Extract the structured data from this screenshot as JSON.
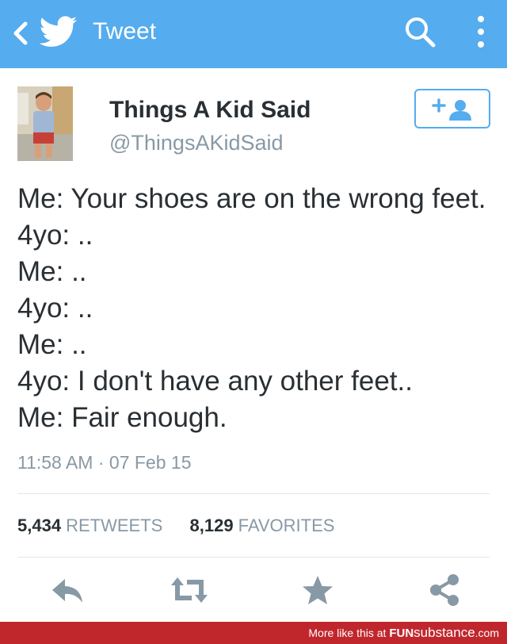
{
  "topbar": {
    "title": "Tweet",
    "background_color": "#55acee",
    "icons": [
      "chevron-left-icon",
      "twitter-bird-icon",
      "search-icon",
      "overflow-menu-icon"
    ]
  },
  "header": {
    "display_name": "Things A Kid Said",
    "handle": "@ThingsAKidSaid",
    "follow_button_icon": "add-user-icon"
  },
  "tweet": {
    "lines": [
      "Me: Your shoes are on the wrong feet.",
      "4yo: ..",
      "Me: ..",
      "4yo: ..",
      "Me: ..",
      "4yo: I don't have any other feet..",
      "Me: Fair enough."
    ],
    "timestamp": "11:58 AM · 07 Feb 15"
  },
  "stats": {
    "retweets_count": "5,434",
    "retweets_label": "RETWEETS",
    "favorites_count": "8,129",
    "favorites_label": "FAVORITES"
  },
  "actions": [
    "reply-icon",
    "retweet-icon",
    "favorite-star-icon",
    "share-icon"
  ],
  "footer": {
    "prefix": "More like this at ",
    "brand_bold": "FUN",
    "brand_rest": "substance",
    "brand_suffix": ".com",
    "background_color": "#c0272d"
  },
  "colors": {
    "accent": "#55acee",
    "text": "#292f33",
    "secondary_text": "#8899a6",
    "divider": "#e1e8ed",
    "icon_gray": "#8899a6"
  }
}
